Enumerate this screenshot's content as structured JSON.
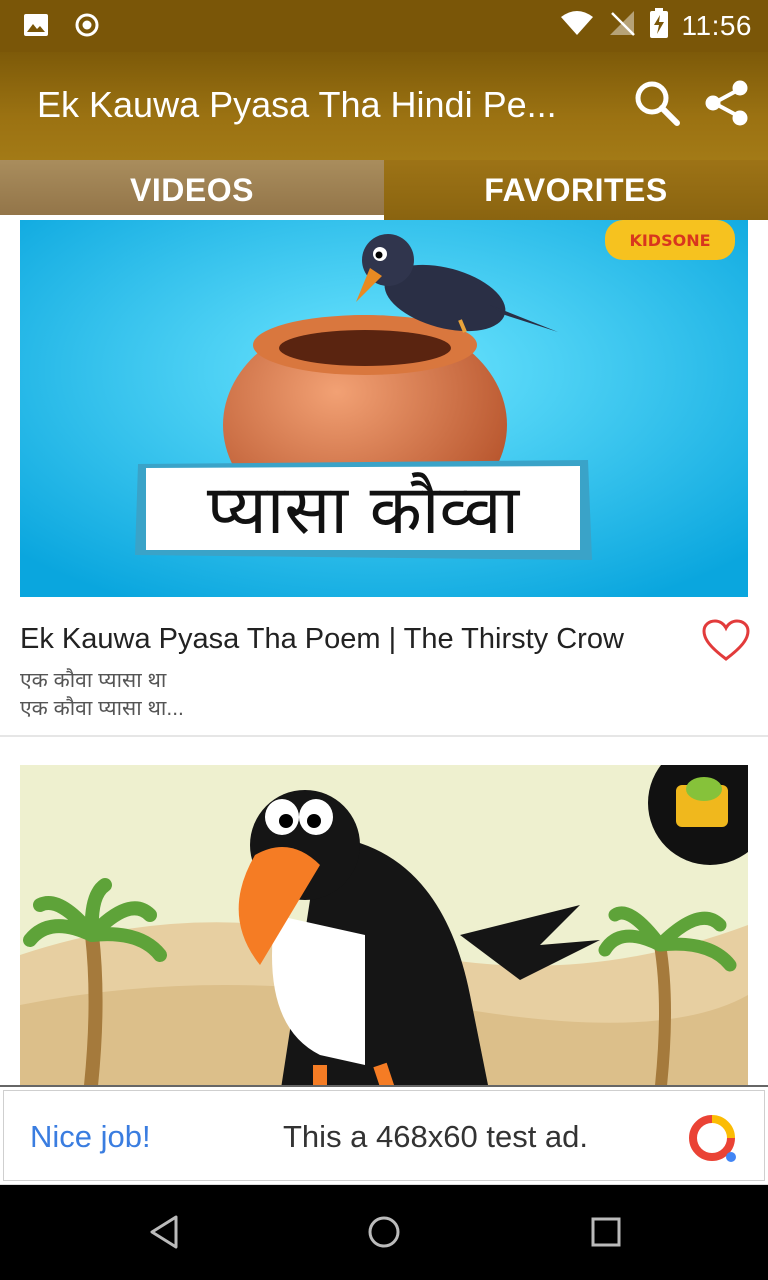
{
  "status_bar": {
    "time": "11:56",
    "icons": [
      "image-icon",
      "record-icon",
      "wifi-icon",
      "signal-off-icon",
      "battery-charging-icon"
    ]
  },
  "app_bar": {
    "title": "Ek Kauwa Pyasa Tha Hindi Pe...",
    "actions": [
      "search-icon",
      "share-icon"
    ]
  },
  "tabs": [
    {
      "label": "VIDEOS",
      "selected": true
    },
    {
      "label": "FAVORITES",
      "selected": false
    }
  ],
  "videos": [
    {
      "thumbnail_text": "प्यासा कौव्वा",
      "thumbnail_badge": "KIDSONE",
      "title": "Ek Kauwa Pyasa Tha Poem | The Thirsty Crow",
      "description_line1": "एक कौवा प्यासा था",
      "description_line2": "एक कौवा प्यासा था...",
      "favorite": false
    },
    {
      "thumbnail_text": "",
      "favorite": false
    }
  ],
  "ad": {
    "headline": "Nice job!",
    "text": "This a 468x60 test ad."
  },
  "colors": {
    "app_bar": "#9b7212",
    "tab_selected": "#a98d5d",
    "ad_blue": "#3a7de0",
    "heart": "#e23b3b"
  }
}
